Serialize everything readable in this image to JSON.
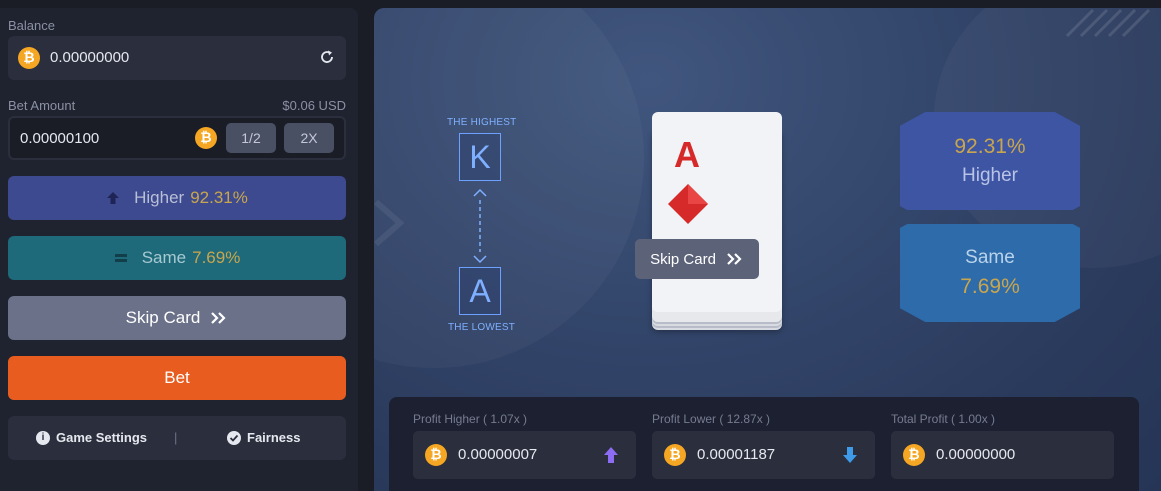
{
  "sidebar": {
    "balance_label": "Balance",
    "balance_value": "0.00000000",
    "bet_amount_label": "Bet Amount",
    "bet_amount_usd": "$0.06 USD",
    "bet_amount_value": "0.00000100",
    "half_label": "1/2",
    "double_label": "2X",
    "higher_label": "Higher",
    "higher_pct": "92.31%",
    "same_label": "Same",
    "same_pct": "7.69%",
    "skip_label": "Skip Card",
    "bet_label": "Bet",
    "game_settings_label": "Game Settings",
    "divider": "|",
    "fairness_label": "Fairness"
  },
  "game": {
    "highest_caption": "THE HIGHEST",
    "highest_card": "K",
    "lowest_caption": "THE LOWEST",
    "lowest_card": "A",
    "current_card_rank": "A",
    "current_card_suit": "diamonds",
    "skip_label": "Skip Card",
    "higher_pct": "92.31%",
    "higher_label": "Higher",
    "same_label": "Same",
    "same_pct": "7.69%"
  },
  "profit": {
    "higher_label": "Profit Higher ( 1.07x )",
    "higher_value": "0.00000007",
    "lower_label": "Profit Lower ( 12.87x )",
    "lower_value": "0.00001187",
    "total_label": "Total Profit ( 1.00x )",
    "total_value": "0.00000000"
  },
  "colors": {
    "higher": "#3d4a8f",
    "same": "#1e6a7a",
    "skip": "#6b7188",
    "bet": "#e85d1f",
    "pct_gold": "#c9a64d",
    "coin": "#f5a623"
  }
}
